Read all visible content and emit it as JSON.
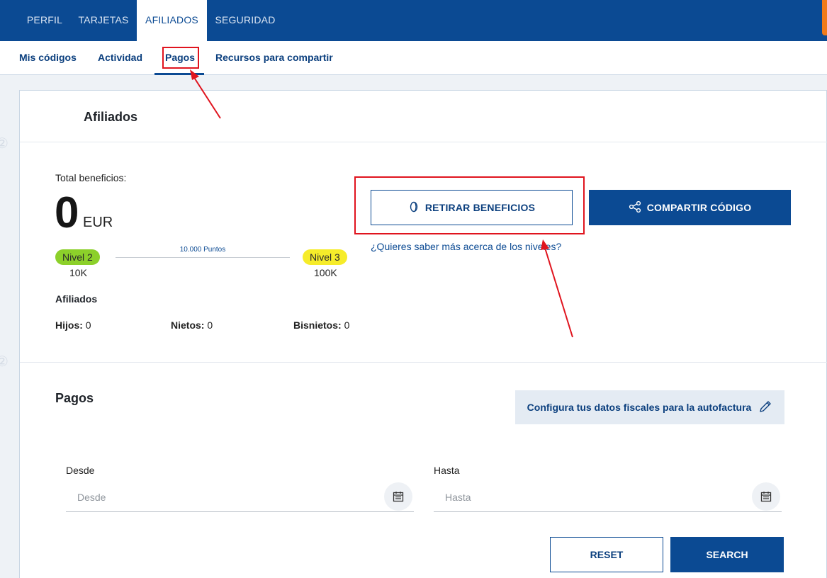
{
  "top_nav": {
    "tabs": [
      {
        "label": "PERFIL"
      },
      {
        "label": "TARJETAS"
      },
      {
        "label": "AFILIADOS"
      },
      {
        "label": "SEGURIDAD"
      }
    ],
    "active": "AFILIADOS"
  },
  "sub_nav": {
    "tabs": [
      {
        "label": "Mis códigos"
      },
      {
        "label": "Actividad"
      },
      {
        "label": "Pagos"
      },
      {
        "label": "Recursos para compartir"
      }
    ],
    "active": "Pagos"
  },
  "card": {
    "title": "Afiliados",
    "total_label": "Total beneficios:",
    "total_value": "0",
    "total_unit": "EUR",
    "level_current": {
      "label": "Nivel 2",
      "sub": "10K",
      "color": "#8cd02a"
    },
    "level_next": {
      "label": "Nivel 3",
      "sub": "100K",
      "color": "#f6ec2a"
    },
    "progress_label": "10.000 Puntos",
    "affiliates_title": "Afiliados",
    "stats": [
      {
        "label": "Hijos:",
        "value": "0"
      },
      {
        "label": "Nietos:",
        "value": "0"
      },
      {
        "label": "Bisnietos:",
        "value": "0"
      }
    ],
    "withdraw_button": "RETIRAR BENEFICIOS",
    "share_button": "COMPARTIR CÓDIGO",
    "levels_link": "¿Quieres saber más acerca de los niveles?"
  },
  "payments": {
    "title": "Pagos",
    "fiscal_button": "Configura tus datos fiscales para la autofactura",
    "from": {
      "label": "Desde",
      "placeholder": "Desde"
    },
    "to": {
      "label": "Hasta",
      "placeholder": "Hasta"
    },
    "reset_button": "RESET",
    "search_button": "SEARCH"
  },
  "colors": {
    "brand": "#0b4a93",
    "annotation": "#e0141e",
    "accent": "#f07a1a"
  }
}
